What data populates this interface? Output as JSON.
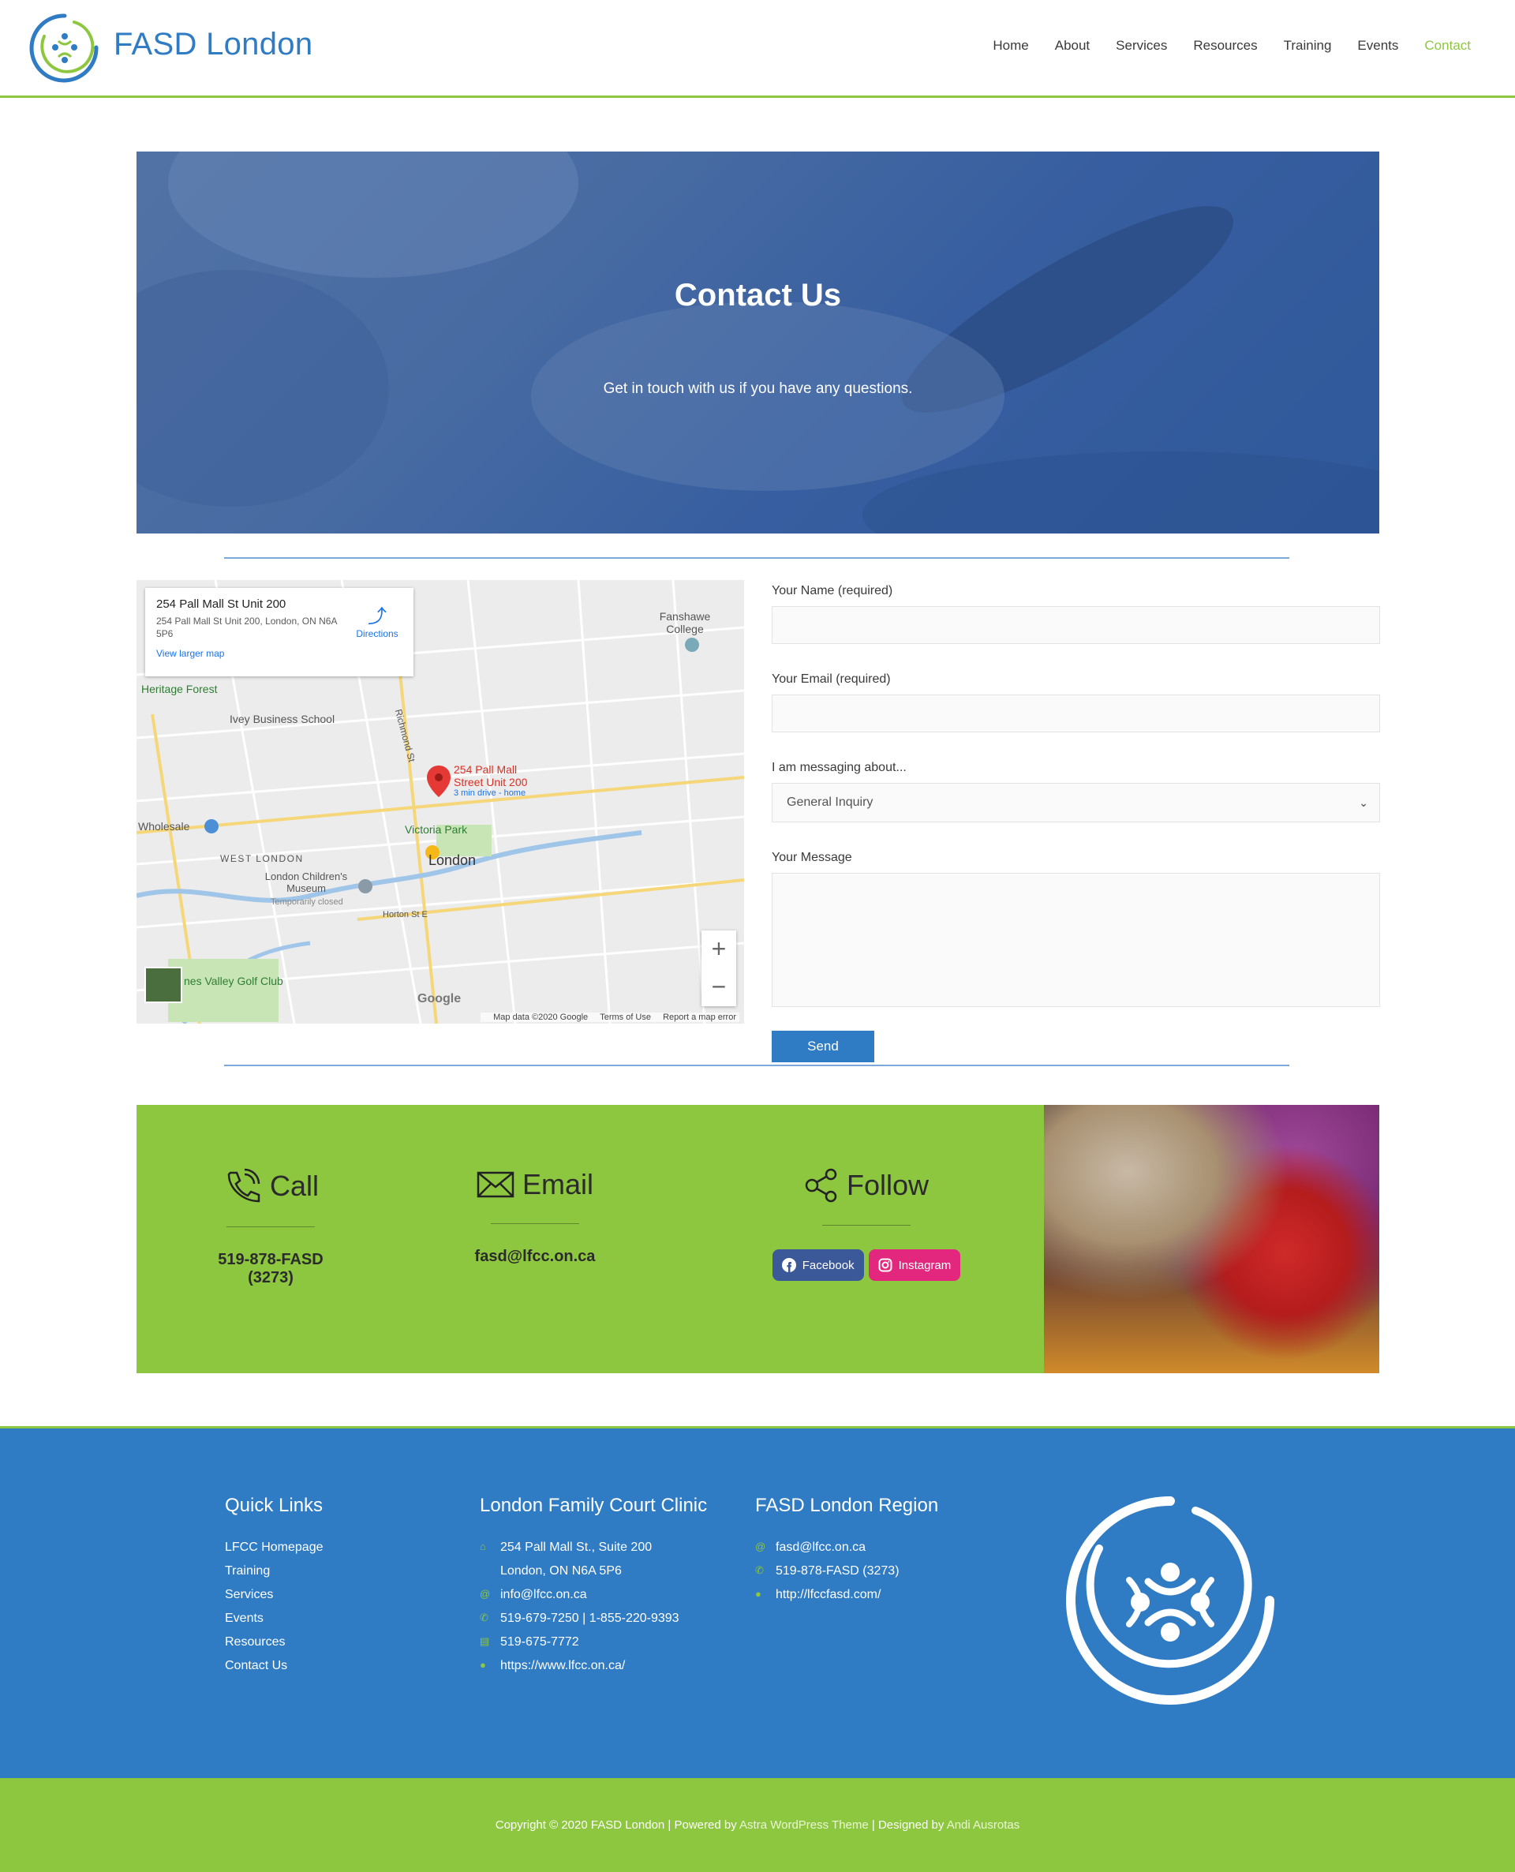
{
  "site": {
    "title": "FASD London"
  },
  "nav": {
    "items": [
      "Home",
      "About",
      "Services",
      "Resources",
      "Training",
      "Events",
      "Contact"
    ]
  },
  "hero": {
    "title": "Contact Us",
    "subtitle": "Get in touch with us if you have any questions."
  },
  "map": {
    "card_title": "254 Pall Mall St Unit 200",
    "card_address": "254 Pall Mall St Unit 200, London, ON N6A 5P6",
    "directions": "Directions",
    "view_larger": "View larger map",
    "pin_label": "254 Pall Mall Street Unit 200",
    "pin_sub": "3 min drive - home",
    "google": "Google",
    "footer_data": "Map data ©2020 Google",
    "footer_terms": "Terms of Use",
    "footer_report": "Report a map error",
    "labels": {
      "fanshawe": "Fanshawe College",
      "heritage": "Heritage Forest",
      "ivey": "Ivey Business School",
      "wholesale": "Wholesale",
      "west_london": "WEST LONDON",
      "victoria_park": "Victoria Park",
      "london": "London",
      "childrens_museum": "London Children's Museum",
      "temp_closed": "Temporarily closed",
      "golf": "nes Valley Golf Club",
      "richmond": "Richmond St",
      "horton": "Horton St E"
    }
  },
  "form": {
    "name_label": "Your Name (required)",
    "email_label": "Your Email (required)",
    "about_label": "I am messaging about...",
    "about_selected": "General Inquiry",
    "message_label": "Your Message",
    "send": "Send"
  },
  "contact": {
    "call_title": "Call",
    "call_value": "519-878-FASD (3273)",
    "email_title": "Email",
    "email_value": "fasd@lfcc.on.ca",
    "follow_title": "Follow",
    "facebook": "Facebook",
    "instagram": "Instagram"
  },
  "footer": {
    "quick_title": "Quick Links",
    "quick_links": [
      "LFCC Homepage",
      "Training",
      "Services",
      "Events",
      "Resources",
      "Contact Us"
    ],
    "clinic_title": "London Family Court Clinic",
    "clinic_addr1": "254 Pall Mall St., Suite 200",
    "clinic_addr2": "London, ON N6A 5P6",
    "clinic_email": "info@lfcc.on.ca",
    "clinic_phone": "519-679-7250 | 1-855-220-9393",
    "clinic_fax": "519-675-7772",
    "clinic_web": "https://www.lfcc.on.ca/",
    "region_title": "FASD London Region",
    "region_email": "fasd@lfcc.on.ca",
    "region_phone": "519-878-FASD (3273)",
    "region_web": "http://lfccfasd.com/"
  },
  "bottom": {
    "prefix": "Copyright © 2020 FASD London | Powered by",
    "theme": "Astra WordPress Theme",
    "middle": "| Designed by",
    "designer": "Andi Ausrotas"
  },
  "colors": {
    "brand_blue": "#2f7bc4",
    "brand_green": "#8dc63f",
    "facebook": "#3b5998",
    "instagram": "#e4277e"
  },
  "icons": {
    "call": "phone-icon",
    "email": "envelope-icon",
    "follow": "share-icon",
    "address": "home-icon",
    "mail": "at-icon",
    "phone": "phone-icon",
    "fax": "fax-icon",
    "web": "globe-icon"
  }
}
